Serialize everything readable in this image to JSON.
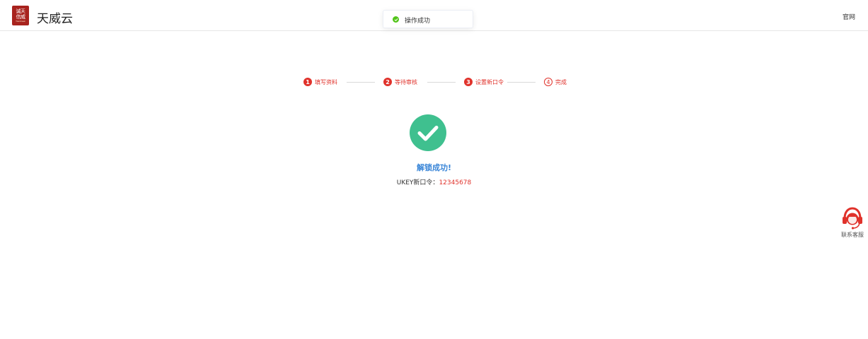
{
  "header": {
    "logo_glyphs": [
      "诚天",
      "信威"
    ],
    "logo_subtext": "TianDesk",
    "brand": "天威云",
    "official_link": "官网"
  },
  "toast": {
    "icon": "check-circle-icon",
    "text": "操作成功"
  },
  "steps": [
    {
      "num": "1",
      "label": "填写资料",
      "state": "done"
    },
    {
      "num": "2",
      "label": "等待审核",
      "state": "done"
    },
    {
      "num": "3",
      "label": "设置新口令",
      "state": "done"
    },
    {
      "num": "4",
      "label": "完成",
      "state": "current"
    }
  ],
  "result": {
    "icon": "check-icon",
    "title": "解锁成功!",
    "ukey_label": "UKEY新口令：",
    "ukey_value": "12345678"
  },
  "customer_service": {
    "icon": "headset-icon",
    "label": "联系客服"
  },
  "colors": {
    "accent": "#e0322b",
    "success": "#3fc08f",
    "link": "#3a86d8",
    "toast_success": "#52c41a"
  }
}
